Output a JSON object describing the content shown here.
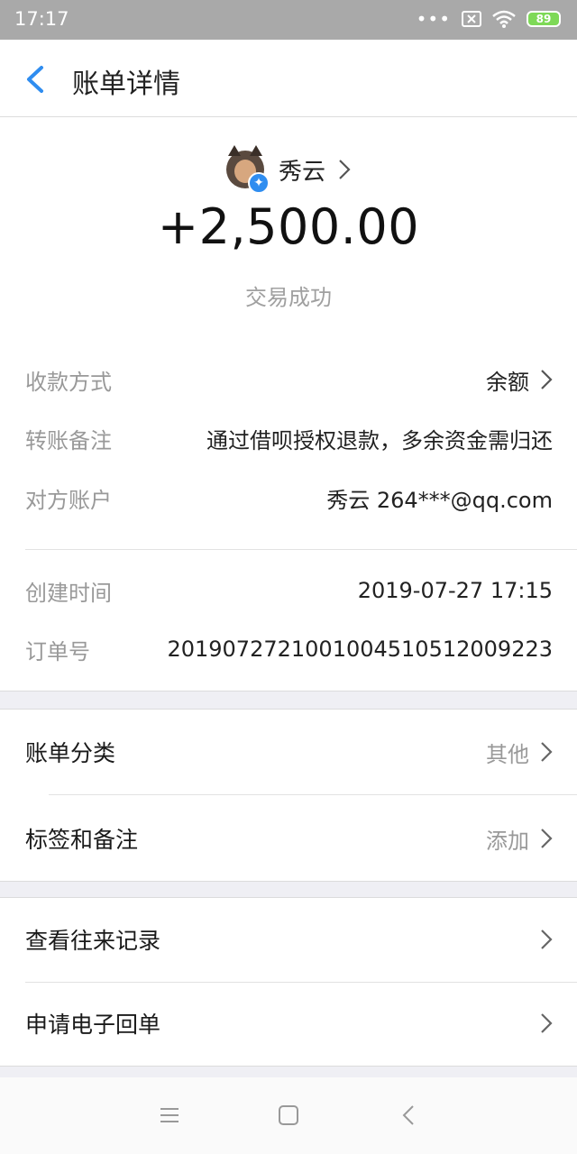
{
  "status_bar": {
    "time": "17:17",
    "battery": "89"
  },
  "header": {
    "title": "账单详情"
  },
  "summary": {
    "payee_name": "秀云",
    "amount": "+2,500.00",
    "status": "交易成功"
  },
  "details": [
    {
      "label": "收款方式",
      "value": "余额",
      "has_chevron": true
    },
    {
      "label": "转账备注",
      "value": "通过借呗授权退款，多余资金需归还",
      "has_chevron": false
    },
    {
      "label": "对方账户",
      "value": "秀云 264***@qq.com",
      "has_chevron": false
    }
  ],
  "meta": [
    {
      "label": "创建时间",
      "value": "2019-07-27 17:15"
    },
    {
      "label": "订单号",
      "value": "20190727210010045105120​09223"
    }
  ],
  "classification": {
    "category_label": "账单分类",
    "category_value": "其他",
    "tags_label": "标签和备注",
    "tags_value": "添加"
  },
  "actions": {
    "history_label": "查看往来记录",
    "receipt_label": "申请电子回单"
  },
  "icons": {
    "back": "back-arrow-icon",
    "chevron": "chevron-right-icon",
    "verified": "verified-badge-icon",
    "sys_menu": "menu-icon",
    "sys_home": "home-square-icon",
    "sys_back": "back-triangle-icon"
  },
  "colors": {
    "accent": "#2f8df0",
    "status_bar": "#a9a9a9"
  }
}
